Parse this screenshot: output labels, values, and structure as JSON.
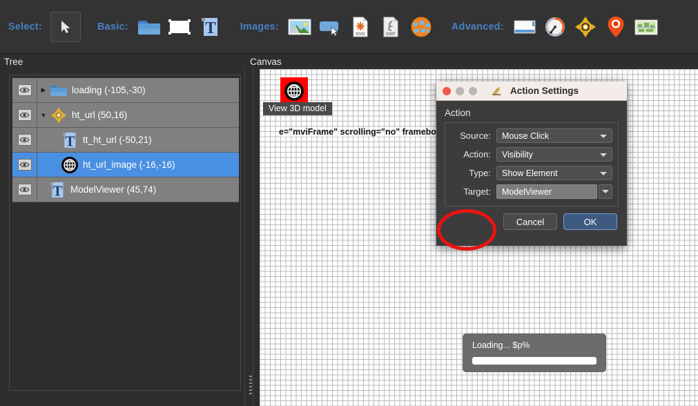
{
  "toolbar": {
    "groups": [
      {
        "label": "Select:",
        "items": [
          {
            "name": "cursor-icon",
            "title": "Select tool"
          }
        ]
      },
      {
        "label": "Basic:",
        "items": [
          {
            "name": "folder-icon",
            "title": "Folder"
          },
          {
            "name": "rectangle-icon",
            "title": "Rectangle"
          },
          {
            "name": "text-icon",
            "title": "Text"
          }
        ]
      },
      {
        "label": "Images:",
        "items": [
          {
            "name": "image-icon",
            "title": "Image"
          },
          {
            "name": "button-icon",
            "title": "Button"
          },
          {
            "name": "svg-file-icon",
            "title": "SVG",
            "badge": "SVG"
          },
          {
            "name": "swf-file-icon",
            "title": "SWF",
            "badge": "SWF"
          },
          {
            "name": "globe-icon",
            "title": "Web"
          }
        ]
      },
      {
        "label": "Advanced:",
        "items": [
          {
            "name": "window-icon",
            "title": "Window"
          },
          {
            "name": "gauge-icon",
            "title": "Gauge"
          },
          {
            "name": "crosshair-icon",
            "title": "Hotspot"
          },
          {
            "name": "map-pin-icon",
            "title": "Map pin"
          },
          {
            "name": "map-thumbnail-icon",
            "title": "Map"
          }
        ]
      }
    ]
  },
  "panels": {
    "tree_title": "Tree",
    "canvas_title": "Canvas"
  },
  "tree": {
    "rows": [
      {
        "label": "loading (-105,-30)",
        "icon": "folder-icon",
        "twisty": "▶",
        "indent": 0,
        "selected": false
      },
      {
        "label": "ht_url (50,16)",
        "icon": "crosshair-icon",
        "twisty": "▼",
        "indent": 0,
        "selected": false
      },
      {
        "label": "tt_ht_url (-50,21)",
        "icon": "text-icon",
        "twisty": "",
        "indent": 1,
        "selected": false
      },
      {
        "label": "ht_url_image (-16,-16)",
        "icon": "globe-dark-icon",
        "twisty": "",
        "indent": 1,
        "selected": true
      },
      {
        "label": "ModelViewer (45,74)",
        "icon": "text-icon",
        "twisty": "",
        "indent": 1,
        "selected": false
      }
    ]
  },
  "canvas": {
    "globe_widget_label": "View 3D model",
    "iframe_code_text": "e=\"mviFrame\" scrolling=\"no\" framebo",
    "loading": {
      "text": "Loading... $p%",
      "progress": 100
    }
  },
  "dialog": {
    "title": "Action Settings",
    "section_label": "Action",
    "fields": [
      {
        "label": "Source:",
        "value": "Mouse Click",
        "style": "combo"
      },
      {
        "label": "Action:",
        "value": "Visibility",
        "style": "combo"
      },
      {
        "label": "Type:",
        "value": "Show Element",
        "style": "combo"
      },
      {
        "label": "Target:",
        "value": "ModelViewer",
        "style": "split"
      }
    ],
    "buttons": {
      "cancel": "Cancel",
      "ok": "OK"
    }
  },
  "colors": {
    "accent_blue": "#4a7fc1",
    "selection_blue": "#4a90e2",
    "annotation_red": "#ee1111",
    "toolbar_bg": "#333333",
    "panel_bg": "#2e2e2e",
    "dialog_bg": "#3c3c3c",
    "titlebar_bg": "#f3ece8"
  }
}
